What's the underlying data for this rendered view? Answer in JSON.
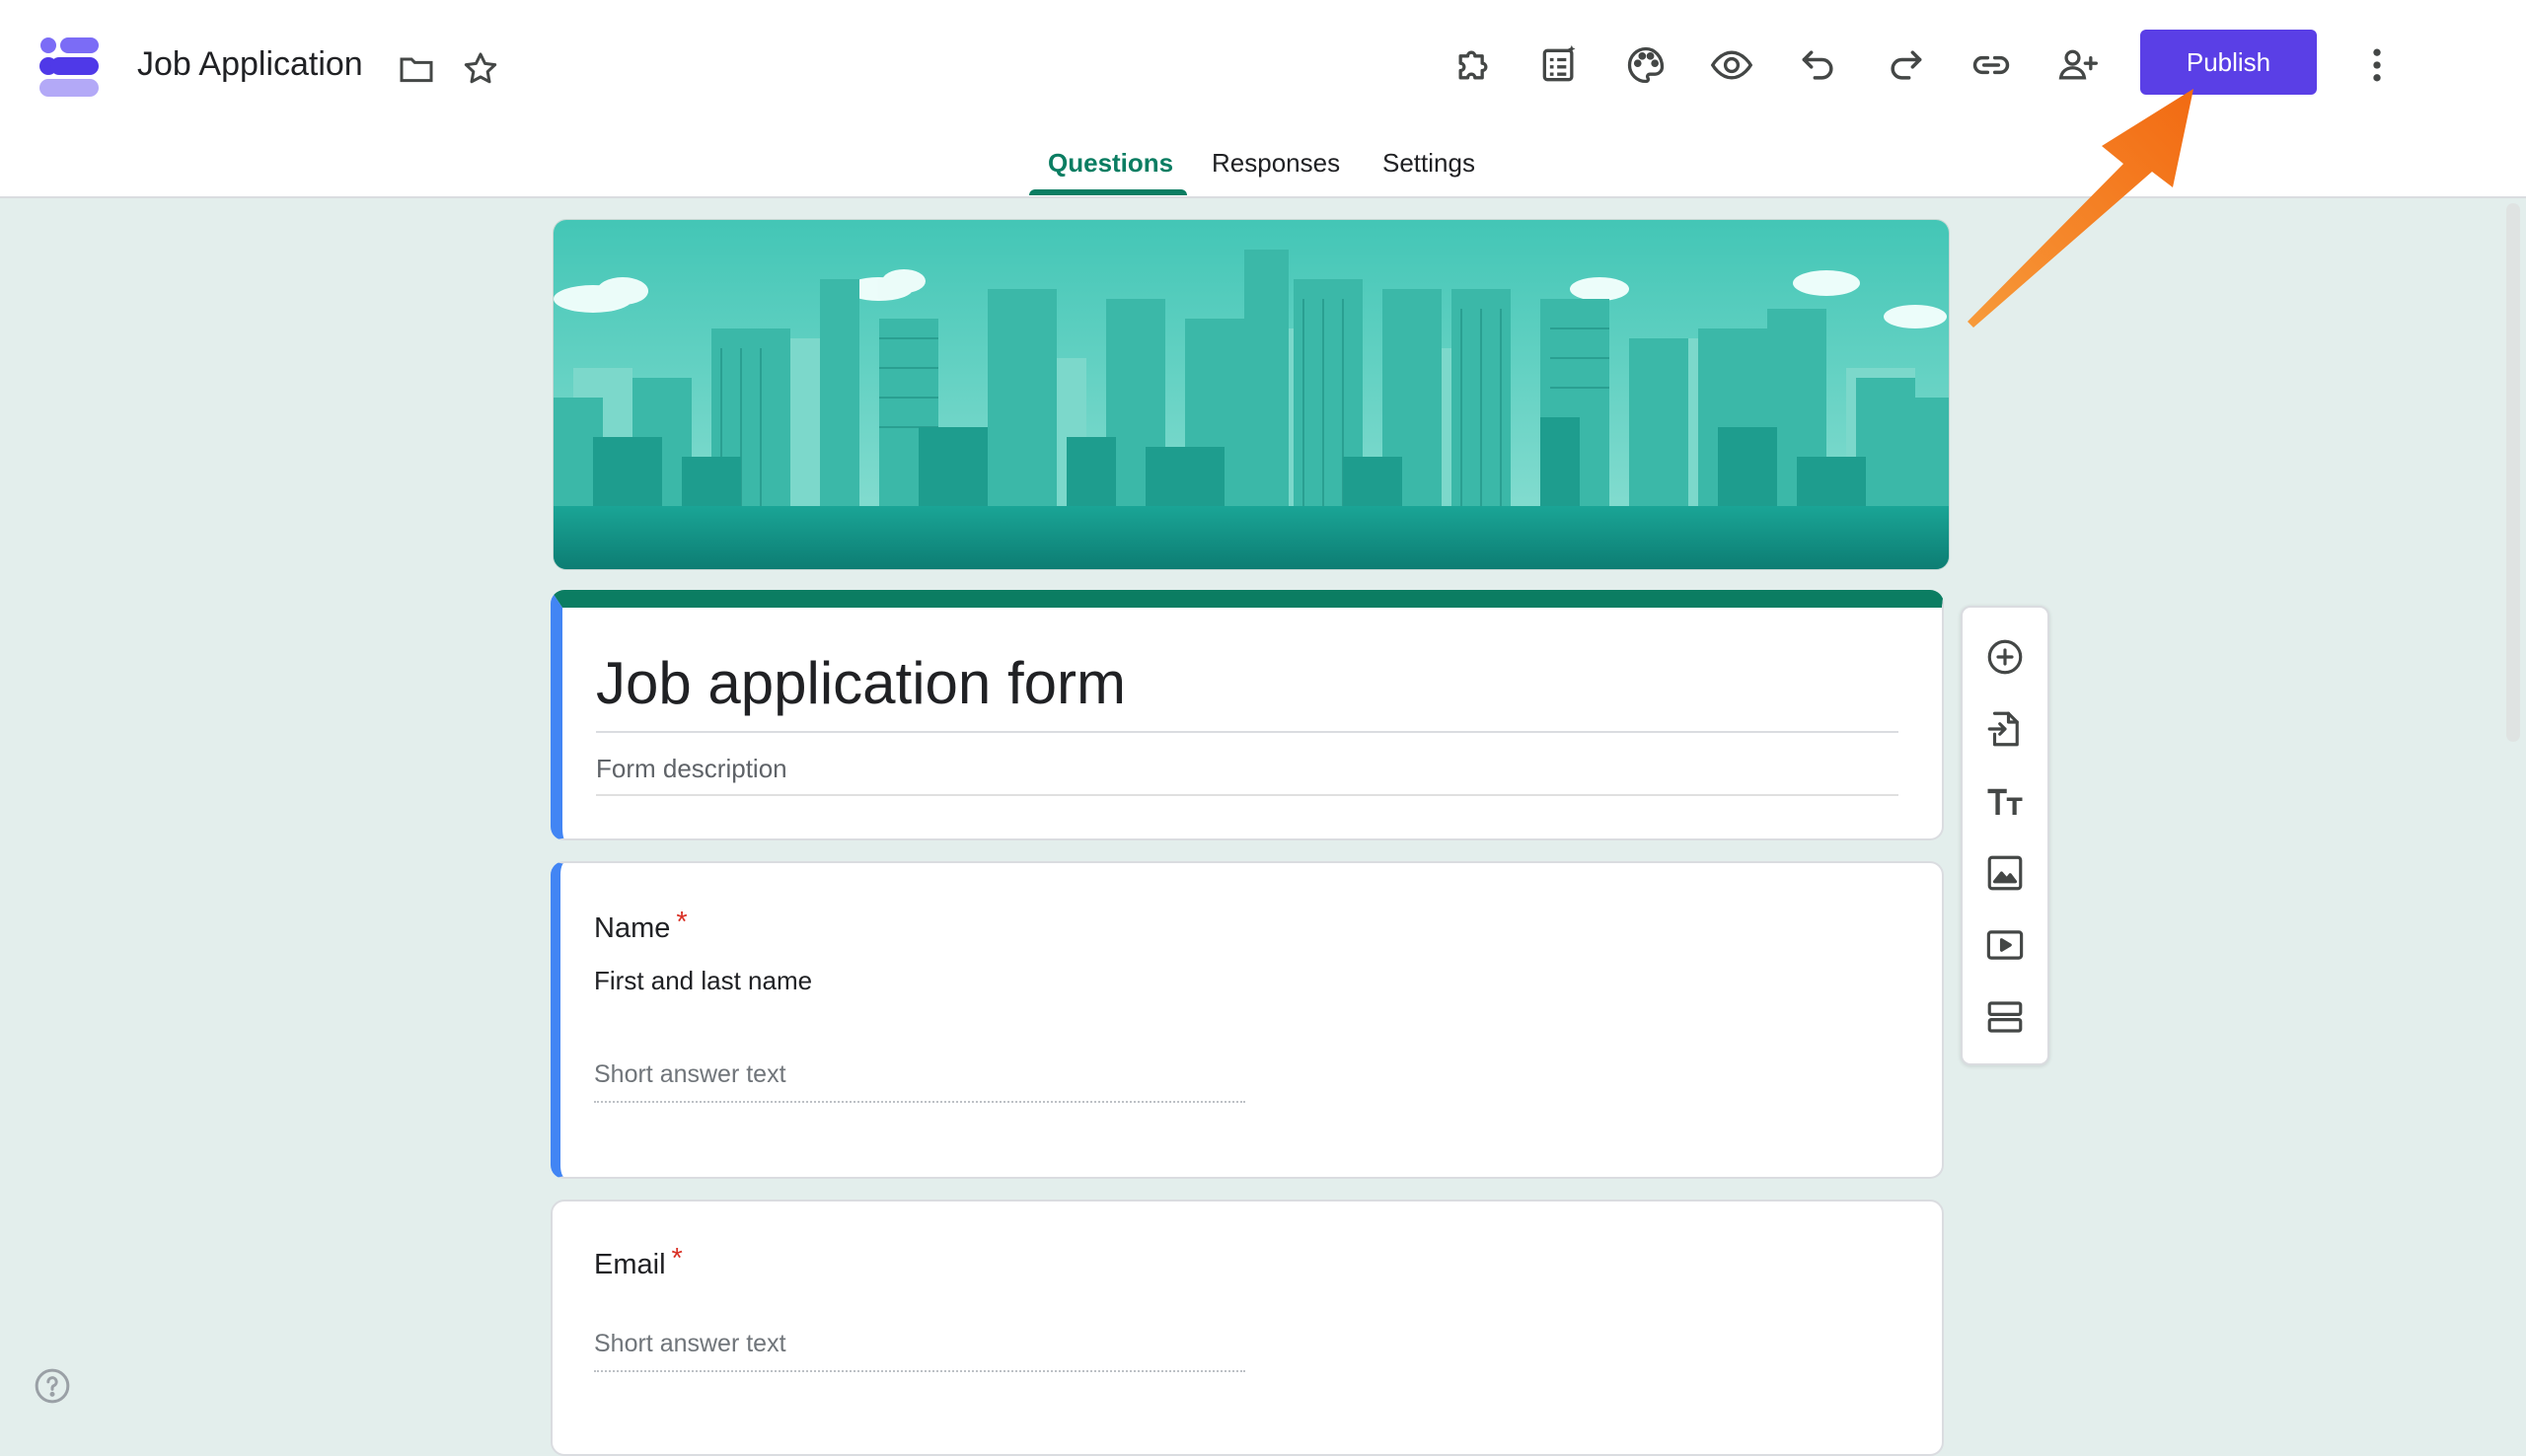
{
  "app": {
    "logo_icon": "forms-logo-icon"
  },
  "header": {
    "doc_title": "Job Application",
    "folder_icon": "folder-icon",
    "star_icon": "star-icon",
    "toolbar": [
      {
        "name": "addons-icon"
      },
      {
        "name": "ai-checklist-icon"
      },
      {
        "name": "palette-icon"
      },
      {
        "name": "preview-icon"
      },
      {
        "name": "undo-icon"
      },
      {
        "name": "redo-icon"
      },
      {
        "name": "link-icon"
      },
      {
        "name": "add-collaborator-icon"
      }
    ],
    "publish_label": "Publish",
    "more_icon": "more-vert-icon",
    "accent": "#5a3fe6"
  },
  "tabs": [
    {
      "label": "Questions",
      "active": true
    },
    {
      "label": "Responses",
      "active": false
    },
    {
      "label": "Settings",
      "active": false
    }
  ],
  "form": {
    "title": "Job application form",
    "description_placeholder": "Form description",
    "theme_color": "#0b7d62",
    "questions": [
      {
        "label": "Name",
        "required": "*",
        "description": "First and last name",
        "answer_placeholder": "Short answer text"
      },
      {
        "label": "Email",
        "required": "*",
        "answer_placeholder": "Short answer text"
      }
    ]
  },
  "side_toolbar": [
    {
      "name": "add-question-icon"
    },
    {
      "name": "import-questions-icon"
    },
    {
      "name": "add-title-icon"
    },
    {
      "name": "add-image-icon"
    },
    {
      "name": "add-video-icon"
    },
    {
      "name": "add-section-icon"
    }
  ],
  "help_icon": "help-icon",
  "annotation": {
    "arrow_color": "#f2711c"
  }
}
